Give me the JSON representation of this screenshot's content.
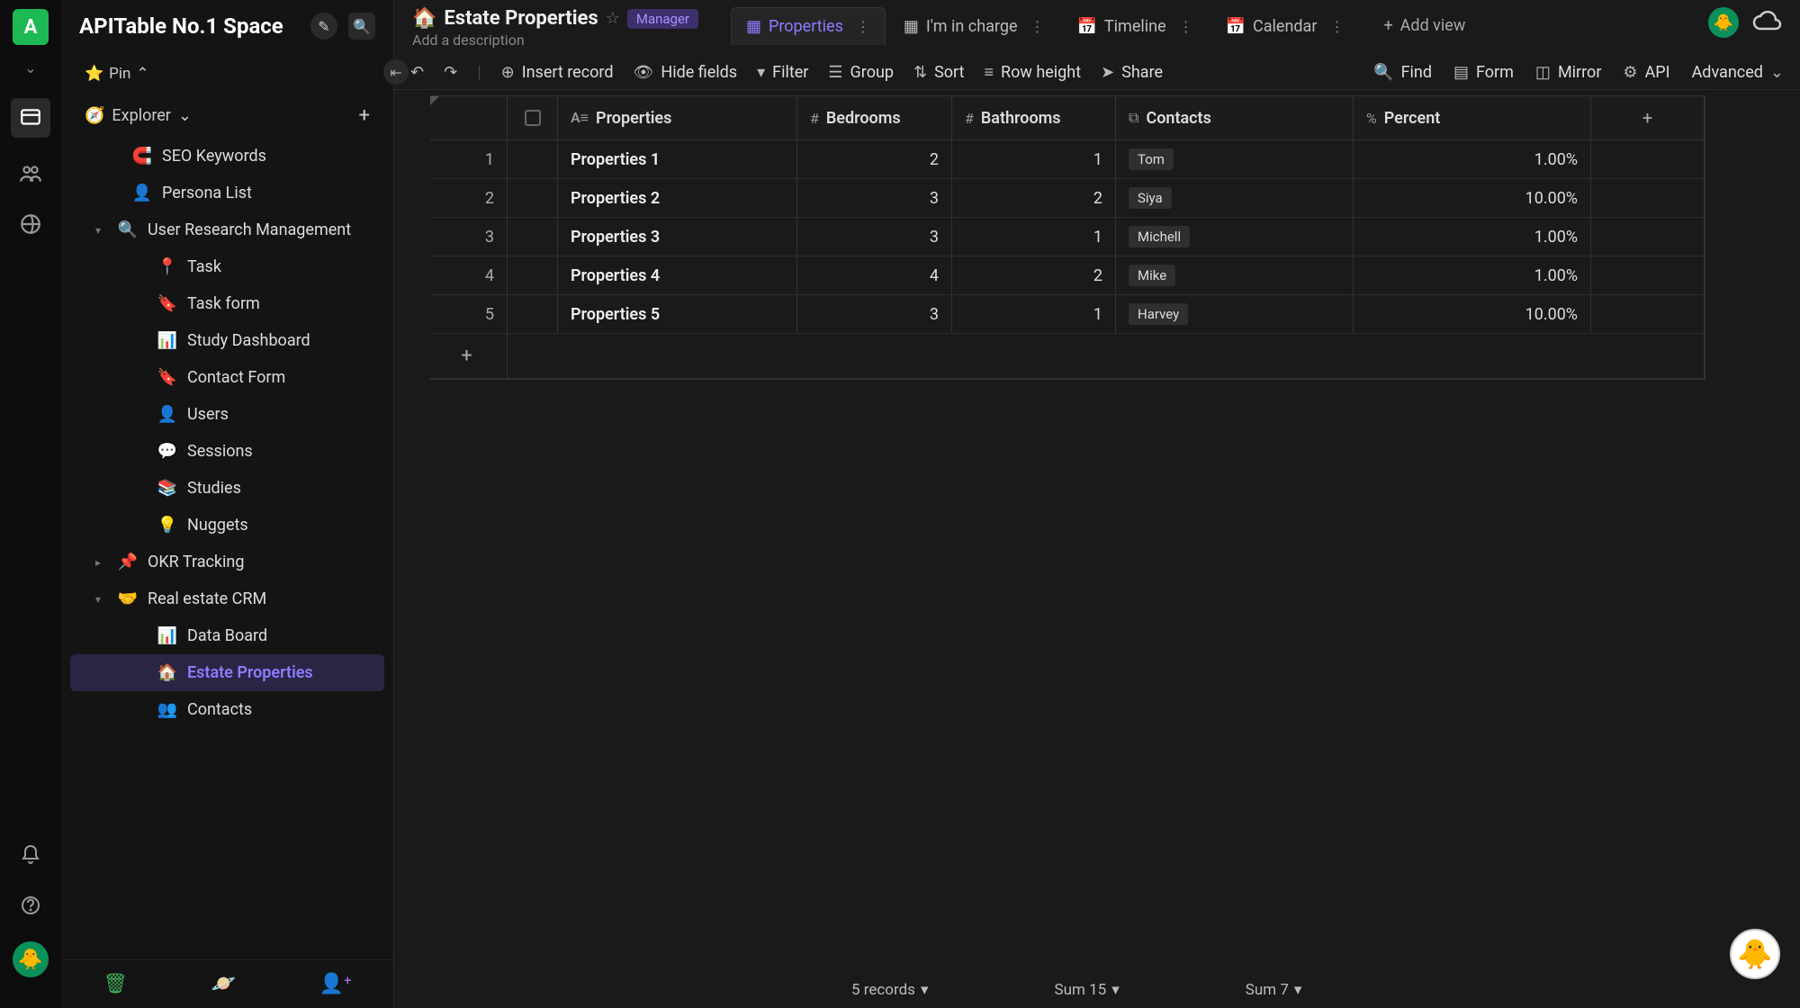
{
  "workspace": {
    "initial": "A",
    "title": "APITable No.1 Space"
  },
  "sidebar": {
    "pin_label": "Pin",
    "explorer_label": "Explorer",
    "items": [
      {
        "emoji": "🧲",
        "label": "SEO Keywords",
        "indent": 1
      },
      {
        "emoji": "👤",
        "label": "Persona List",
        "indent": 1
      },
      {
        "emoji": "🔍",
        "label": "User Research Management",
        "indent": 0,
        "caret": "▾"
      },
      {
        "emoji": "📍",
        "label": "Task",
        "indent": 2
      },
      {
        "emoji": "🔖",
        "label": "Task form",
        "indent": 2
      },
      {
        "emoji": "📊",
        "label": "Study Dashboard",
        "indent": 2
      },
      {
        "emoji": "🔖",
        "label": "Contact Form",
        "indent": 2
      },
      {
        "emoji": "👤",
        "label": "Users",
        "indent": 2
      },
      {
        "emoji": "💬",
        "label": "Sessions",
        "indent": 2
      },
      {
        "emoji": "📚",
        "label": "Studies",
        "indent": 2
      },
      {
        "emoji": "💡",
        "label": "Nuggets",
        "indent": 2
      },
      {
        "emoji": "📌",
        "label": "OKR Tracking",
        "indent": 0,
        "caret": "▸"
      },
      {
        "emoji": "🤝",
        "label": "Real estate CRM",
        "indent": 0,
        "caret": "▾"
      },
      {
        "emoji": "📊",
        "label": "Data Board",
        "indent": 2
      },
      {
        "emoji": "🏠",
        "label": "Estate Properties",
        "indent": 2,
        "active": true
      },
      {
        "emoji": "👥",
        "label": "Contacts",
        "indent": 2
      }
    ]
  },
  "doc": {
    "emoji": "🏠",
    "title": "Estate Properties",
    "badge": "Manager",
    "desc": "Add a description"
  },
  "views": [
    {
      "icon": "▦",
      "label": "Properties",
      "active": true
    },
    {
      "icon": "▦",
      "label": "I'm in charge"
    },
    {
      "icon": "📅",
      "label": "Timeline"
    },
    {
      "icon": "📅",
      "label": "Calendar"
    }
  ],
  "add_view_label": "Add view",
  "toolbar": {
    "insert": "Insert record",
    "hide": "Hide fields",
    "filter": "Filter",
    "group": "Group",
    "sort": "Sort",
    "rowheight": "Row height",
    "share": "Share",
    "find": "Find",
    "form": "Form",
    "mirror": "Mirror",
    "api": "API",
    "advanced": "Advanced"
  },
  "columns": {
    "properties": "Properties",
    "bedrooms": "Bedrooms",
    "bathrooms": "Bathrooms",
    "contacts": "Contacts",
    "percent": "Percent"
  },
  "rows": [
    {
      "idx": "1",
      "prop": "Properties 1",
      "bed": "2",
      "bath": "1",
      "contact": "Tom",
      "percent": "1.00%"
    },
    {
      "idx": "2",
      "prop": "Properties 2",
      "bed": "3",
      "bath": "2",
      "contact": "Siya",
      "percent": "10.00%"
    },
    {
      "idx": "3",
      "prop": "Properties 3",
      "bed": "3",
      "bath": "1",
      "contact": "Michell",
      "percent": "1.00%"
    },
    {
      "idx": "4",
      "prop": "Properties 4",
      "bed": "4",
      "bath": "2",
      "contact": "Mike",
      "percent": "1.00%"
    },
    {
      "idx": "5",
      "prop": "Properties 5",
      "bed": "3",
      "bath": "1",
      "contact": "Harvey",
      "percent": "10.00%"
    }
  ],
  "status": {
    "records": "5 records",
    "sum_bed": "Sum 15",
    "sum_bath": "Sum 7"
  }
}
